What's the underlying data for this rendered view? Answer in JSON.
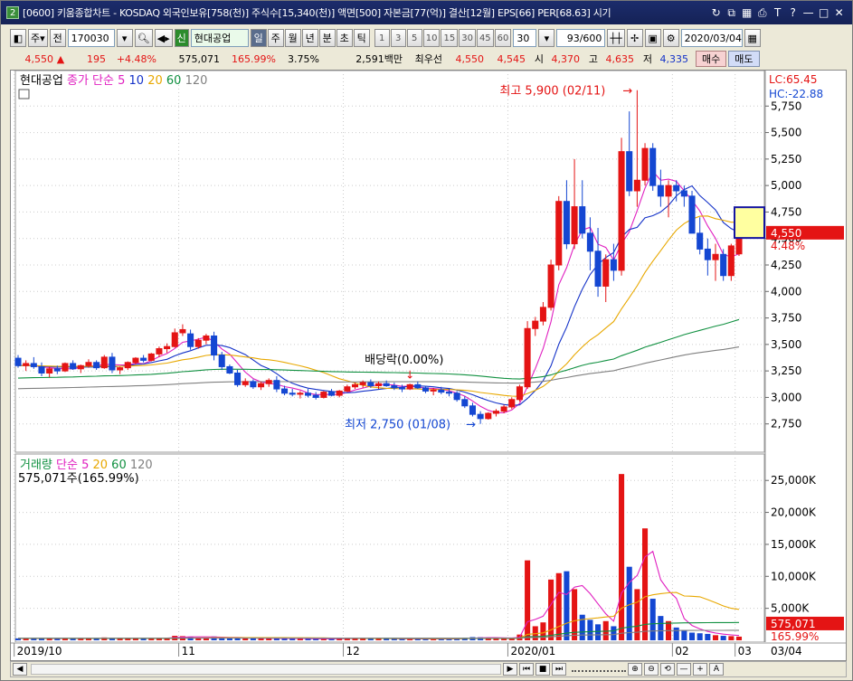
{
  "window": {
    "app_badge": "2",
    "title": "[0600] 키움종합차트 - KOSDAQ 외국인보유[758(천)] 주식수[15,340(천)] 액면[500] 자본금[77(억)] 결산[12월] EPS[66] PER[68.63] 시기"
  },
  "toolbar": {
    "type_label": "주",
    "prev_label": "전",
    "code_value": "170030",
    "credit_badge": "신",
    "stock_name": "현대공업",
    "period_buttons": [
      "일",
      "주",
      "월",
      "년",
      "분",
      "초",
      "틱"
    ],
    "selected_period": "일",
    "interval_buttons": [
      "1",
      "3",
      "5",
      "10",
      "15",
      "30",
      "45",
      "60"
    ],
    "interval_value": "30",
    "count_value": "93/600",
    "date_value": "2020/03/04"
  },
  "quote": {
    "price": "4,550",
    "arrow": "▲",
    "change": "195",
    "change_pct": "+4.48%",
    "volume": "575,071",
    "volume_ratio": "165.99%",
    "turnover": "3.75%",
    "amount": "2,591백만",
    "best_ask_label": "최우선",
    "best_ask": "4,550",
    "best_bid": "4,545",
    "open_label": "시",
    "open": "4,370",
    "high_label": "고",
    "high": "4,635",
    "low_label": "저",
    "low": "4,335",
    "buy_label": "매수",
    "sell_label": "매도"
  },
  "colors": {
    "up": "#e41414",
    "down": "#1447d2",
    "ma5": "#e020c0",
    "ma10": "#1432c8",
    "ma20": "#e8a800",
    "ma60": "#109040",
    "ma120": "#808080"
  },
  "chart_data": {
    "type": "candlestick",
    "price_panel": {
      "legend_name": "현대공업",
      "legend_series": [
        "종가 단순 5",
        "10",
        "20",
        "60",
        "120"
      ],
      "ylim": [
        2500,
        6000
      ],
      "yticks": [
        "5,750",
        "5,500",
        "5,250",
        "5,000",
        "4,750",
        "4,500",
        "4,250",
        "4,000",
        "3,750",
        "3,500",
        "3,250",
        "3,000",
        "2,750"
      ],
      "lc_label": "LC:65.45",
      "hc_label": "HC:-22.88",
      "last_price_label": "4,550",
      "last_pct_label": "4.48%",
      "annotations": {
        "high": "최고 5,900 (02/11)",
        "low": "최저 2,750 (01/08)",
        "dividend": "배당락(0.00%)"
      },
      "ohlc": [
        [
          3370,
          3400,
          3280,
          3300
        ],
        [
          3300,
          3350,
          3250,
          3320
        ],
        [
          3320,
          3380,
          3270,
          3290
        ],
        [
          3290,
          3330,
          3200,
          3230
        ],
        [
          3230,
          3290,
          3190,
          3270
        ],
        [
          3270,
          3300,
          3220,
          3250
        ],
        [
          3250,
          3330,
          3240,
          3320
        ],
        [
          3320,
          3350,
          3260,
          3270
        ],
        [
          3270,
          3310,
          3230,
          3300
        ],
        [
          3300,
          3360,
          3280,
          3330
        ],
        [
          3330,
          3350,
          3260,
          3280
        ],
        [
          3280,
          3400,
          3270,
          3380
        ],
        [
          3380,
          3420,
          3230,
          3260
        ],
        [
          3260,
          3290,
          3220,
          3280
        ],
        [
          3280,
          3340,
          3260,
          3330
        ],
        [
          3330,
          3380,
          3310,
          3370
        ],
        [
          3370,
          3400,
          3330,
          3350
        ],
        [
          3350,
          3420,
          3340,
          3410
        ],
        [
          3410,
          3480,
          3380,
          3460
        ],
        [
          3460,
          3510,
          3420,
          3480
        ],
        [
          3480,
          3650,
          3470,
          3610
        ],
        [
          3610,
          3690,
          3580,
          3640
        ],
        [
          3600,
          3640,
          3450,
          3480
        ],
        [
          3480,
          3560,
          3460,
          3540
        ],
        [
          3540,
          3600,
          3500,
          3580
        ],
        [
          3580,
          3620,
          3350,
          3400
        ],
        [
          3400,
          3430,
          3260,
          3290
        ],
        [
          3290,
          3310,
          3220,
          3230
        ],
        [
          3230,
          3260,
          3100,
          3120
        ],
        [
          3120,
          3180,
          3100,
          3150
        ],
        [
          3150,
          3170,
          3080,
          3100
        ],
        [
          3100,
          3150,
          3070,
          3130
        ],
        [
          3130,
          3180,
          3100,
          3160
        ],
        [
          3160,
          3200,
          3050,
          3080
        ],
        [
          3080,
          3110,
          3020,
          3040
        ],
        [
          3040,
          3080,
          3010,
          3030
        ],
        [
          3030,
          3060,
          2990,
          3040
        ],
        [
          3040,
          3080,
          3000,
          3020
        ],
        [
          3020,
          3050,
          2980,
          3000
        ],
        [
          3000,
          3060,
          2990,
          3050
        ],
        [
          3050,
          3080,
          3010,
          3020
        ],
        [
          3020,
          3070,
          3000,
          3060
        ],
        [
          3060,
          3120,
          3050,
          3100
        ],
        [
          3100,
          3140,
          3080,
          3120
        ],
        [
          3120,
          3160,
          3090,
          3140
        ],
        [
          3140,
          3170,
          3090,
          3110
        ],
        [
          3110,
          3150,
          3080,
          3130
        ],
        [
          3130,
          3160,
          3100,
          3110
        ],
        [
          3110,
          3140,
          3070,
          3090
        ],
        [
          3090,
          3120,
          3050,
          3080
        ],
        [
          3080,
          3130,
          3070,
          3120
        ],
        [
          3120,
          3150,
          3080,
          3090
        ],
        [
          3090,
          3110,
          3040,
          3060
        ],
        [
          3060,
          3090,
          3020,
          3070
        ],
        [
          3070,
          3100,
          3030,
          3050
        ],
        [
          3050,
          3080,
          3010,
          3040
        ],
        [
          3040,
          3060,
          2960,
          2980
        ],
        [
          2980,
          3010,
          2900,
          2920
        ],
        [
          2920,
          2950,
          2820,
          2840
        ],
        [
          2840,
          2870,
          2750,
          2800
        ],
        [
          2800,
          2860,
          2790,
          2850
        ],
        [
          2850,
          2890,
          2820,
          2870
        ],
        [
          2870,
          2930,
          2850,
          2910
        ],
        [
          2910,
          3000,
          2890,
          2980
        ],
        [
          2980,
          3120,
          2960,
          3100
        ],
        [
          3100,
          3720,
          3080,
          3650
        ],
        [
          3650,
          3760,
          3580,
          3720
        ],
        [
          3720,
          3900,
          3680,
          3850
        ],
        [
          3850,
          4300,
          3820,
          4250
        ],
        [
          4250,
          4900,
          4200,
          4850
        ],
        [
          4850,
          5050,
          4400,
          4450
        ],
        [
          4450,
          5250,
          4400,
          4800
        ],
        [
          4800,
          5050,
          4500,
          4550
        ],
        [
          4550,
          4700,
          4200,
          4380
        ],
        [
          4380,
          4600,
          3950,
          4050
        ],
        [
          4050,
          4350,
          3900,
          4300
        ],
        [
          4300,
          4450,
          4100,
          4200
        ],
        [
          4200,
          5450,
          4150,
          5320
        ],
        [
          5320,
          5700,
          4900,
          4950
        ],
        [
          4950,
          5900,
          4800,
          5050
        ],
        [
          5050,
          5400,
          5000,
          5350
        ],
        [
          5350,
          5400,
          4950,
          5000
        ],
        [
          5000,
          5150,
          4800,
          4900
        ],
        [
          4900,
          5050,
          4700,
          5000
        ],
        [
          5000,
          5050,
          4850,
          4950
        ],
        [
          4950,
          5000,
          4800,
          4900
        ],
        [
          4900,
          4950,
          4600,
          4550
        ],
        [
          4550,
          4700,
          4350,
          4400
        ],
        [
          4400,
          4500,
          4150,
          4300
        ],
        [
          4300,
          4450,
          4100,
          4350
        ],
        [
          4350,
          4400,
          4100,
          4150
        ],
        [
          4150,
          4450,
          4100,
          4430
        ],
        [
          4355,
          4635,
          4335,
          4550
        ]
      ]
    },
    "volume_panel": {
      "legend_name": "거래량",
      "legend_series": [
        "단순 5",
        "20",
        "60",
        "120"
      ],
      "value_label": "575,071주(165.99%)",
      "ylim": [
        0,
        28000
      ],
      "yticks": [
        "25,000K",
        "20,000K",
        "15,000K",
        "10,000K",
        "5,000K"
      ],
      "last_value_label": "575,071",
      "last_pct_label": "165.99%",
      "volumes_k": [
        300,
        250,
        280,
        320,
        260,
        240,
        310,
        270,
        250,
        330,
        290,
        450,
        380,
        260,
        300,
        340,
        290,
        360,
        420,
        380,
        700,
        650,
        520,
        430,
        400,
        600,
        480,
        350,
        420,
        300,
        280,
        310,
        290,
        360,
        260,
        240,
        230,
        250,
        220,
        260,
        240,
        280,
        330,
        300,
        310,
        270,
        260,
        240,
        230,
        220,
        250,
        230,
        210,
        240,
        200,
        190,
        350,
        420,
        500,
        480,
        320,
        300,
        340,
        420,
        900,
        12500,
        2200,
        2800,
        9500,
        10500,
        10800,
        8000,
        4000,
        3200,
        2500,
        3000,
        2200,
        26000,
        11500,
        8000,
        17500,
        6500,
        3800,
        3000,
        2000,
        1600,
        1200,
        1100,
        1000,
        800,
        700,
        650,
        575
      ]
    },
    "x_axis_labels": [
      "2019/10",
      "11",
      "12",
      "2020/01",
      "02",
      "03",
      "03/04"
    ]
  }
}
